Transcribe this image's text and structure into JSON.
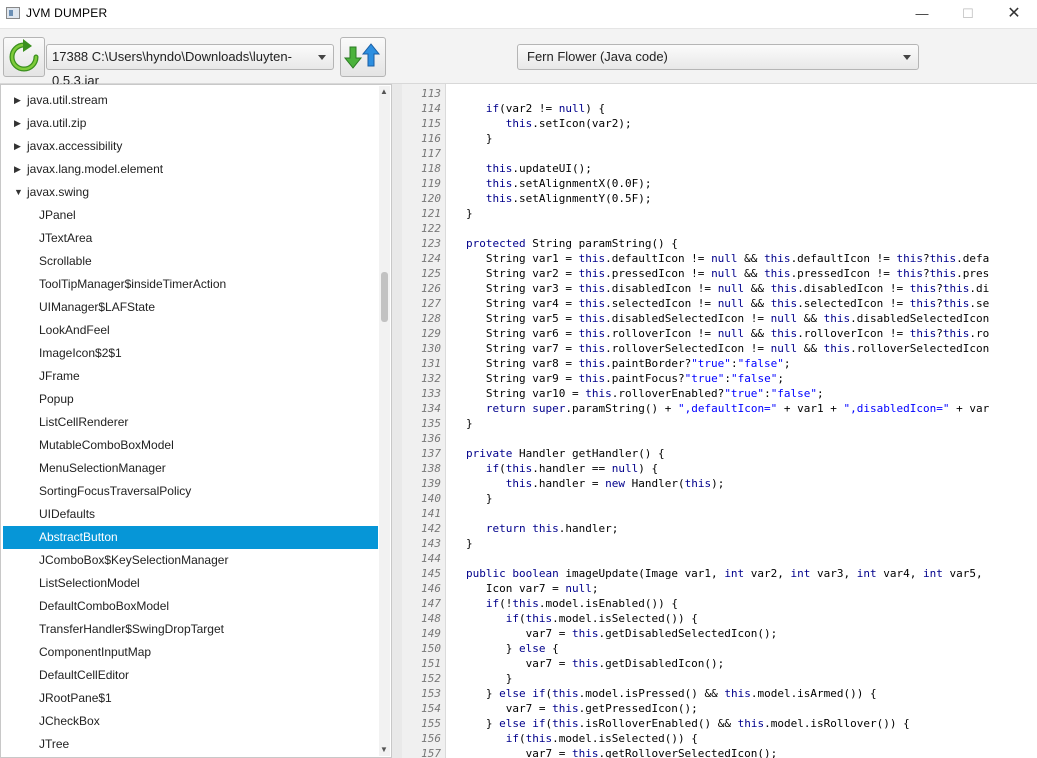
{
  "window": {
    "title": "JVM DUMPER",
    "controls": {
      "minimize": "—",
      "maximize": "☐",
      "close": "✕"
    }
  },
  "toolbar": {
    "process_select": "17388 C:\\Users\\hyndo\\Downloads\\luyten-0.5.3.jar",
    "decompiler_select": "Fern Flower (Java code)",
    "refresh_icon": "refresh-icon",
    "dump_icon": "up-down-arrows-icon"
  },
  "tree": {
    "selected": "AbstractButton",
    "items": [
      {
        "label": "java.util.stream",
        "level": 0,
        "expanded": false
      },
      {
        "label": "java.util.zip",
        "level": 0,
        "expanded": false
      },
      {
        "label": "javax.accessibility",
        "level": 0,
        "expanded": false
      },
      {
        "label": "javax.lang.model.element",
        "level": 0,
        "expanded": false
      },
      {
        "label": "javax.swing",
        "level": 0,
        "expanded": true
      },
      {
        "label": "JPanel",
        "level": 1
      },
      {
        "label": "JTextArea",
        "level": 1
      },
      {
        "label": "Scrollable",
        "level": 1
      },
      {
        "label": "ToolTipManager$insideTimerAction",
        "level": 1
      },
      {
        "label": "UIManager$LAFState",
        "level": 1
      },
      {
        "label": "LookAndFeel",
        "level": 1
      },
      {
        "label": "ImageIcon$2$1",
        "level": 1
      },
      {
        "label": "JFrame",
        "level": 1
      },
      {
        "label": "Popup",
        "level": 1
      },
      {
        "label": "ListCellRenderer",
        "level": 1
      },
      {
        "label": "MutableComboBoxModel",
        "level": 1
      },
      {
        "label": "MenuSelectionManager",
        "level": 1
      },
      {
        "label": "SortingFocusTraversalPolicy",
        "level": 1
      },
      {
        "label": "UIDefaults",
        "level": 1
      },
      {
        "label": "AbstractButton",
        "level": 1
      },
      {
        "label": "JComboBox$KeySelectionManager",
        "level": 1
      },
      {
        "label": "ListSelectionModel",
        "level": 1
      },
      {
        "label": "DefaultComboBoxModel",
        "level": 1
      },
      {
        "label": "TransferHandler$SwingDropTarget",
        "level": 1
      },
      {
        "label": "ComponentInputMap",
        "level": 1
      },
      {
        "label": "DefaultCellEditor",
        "level": 1
      },
      {
        "label": "JRootPane$1",
        "level": 1
      },
      {
        "label": "JCheckBox",
        "level": 1
      },
      {
        "label": "JTree",
        "level": 1
      }
    ]
  },
  "code": {
    "first_line": 113,
    "lines": [
      "",
      "   if(var2 != null) {",
      "      this.setIcon(var2);",
      "   }",
      "",
      "   this.updateUI();",
      "   this.setAlignmentX(0.0F);",
      "   this.setAlignmentY(0.5F);",
      "}",
      "",
      "protected String paramString() {",
      "   String var1 = this.defaultIcon != null && this.defaultIcon != this?this.defa",
      "   String var2 = this.pressedIcon != null && this.pressedIcon != this?this.pres",
      "   String var3 = this.disabledIcon != null && this.disabledIcon != this?this.di",
      "   String var4 = this.selectedIcon != null && this.selectedIcon != this?this.se",
      "   String var5 = this.disabledSelectedIcon != null && this.disabledSelectedIcon",
      "   String var6 = this.rolloverIcon != null && this.rolloverIcon != this?this.ro",
      "   String var7 = this.rolloverSelectedIcon != null && this.rolloverSelectedIcon",
      "   String var8 = this.paintBorder?\"true\":\"false\";",
      "   String var9 = this.paintFocus?\"true\":\"false\";",
      "   String var10 = this.rolloverEnabled?\"true\":\"false\";",
      "   return super.paramString() + \",defaultIcon=\" + var1 + \",disabledIcon=\" + var",
      "}",
      "",
      "private Handler getHandler() {",
      "   if(this.handler == null) {",
      "      this.handler = new Handler(this);",
      "   }",
      "",
      "   return this.handler;",
      "}",
      "",
      "public boolean imageUpdate(Image var1, int var2, int var3, int var4, int var5,",
      "   Icon var7 = null;",
      "   if(!this.model.isEnabled()) {",
      "      if(this.model.isSelected()) {",
      "         var7 = this.getDisabledSelectedIcon();",
      "      } else {",
      "         var7 = this.getDisabledIcon();",
      "      }",
      "   } else if(this.model.isPressed() && this.model.isArmed()) {",
      "      var7 = this.getPressedIcon();",
      "   } else if(this.isRolloverEnabled() && this.model.isRollover()) {",
      "      if(this.model.isSelected()) {",
      "         var7 = this.getRolloverSelectedIcon();"
    ]
  }
}
